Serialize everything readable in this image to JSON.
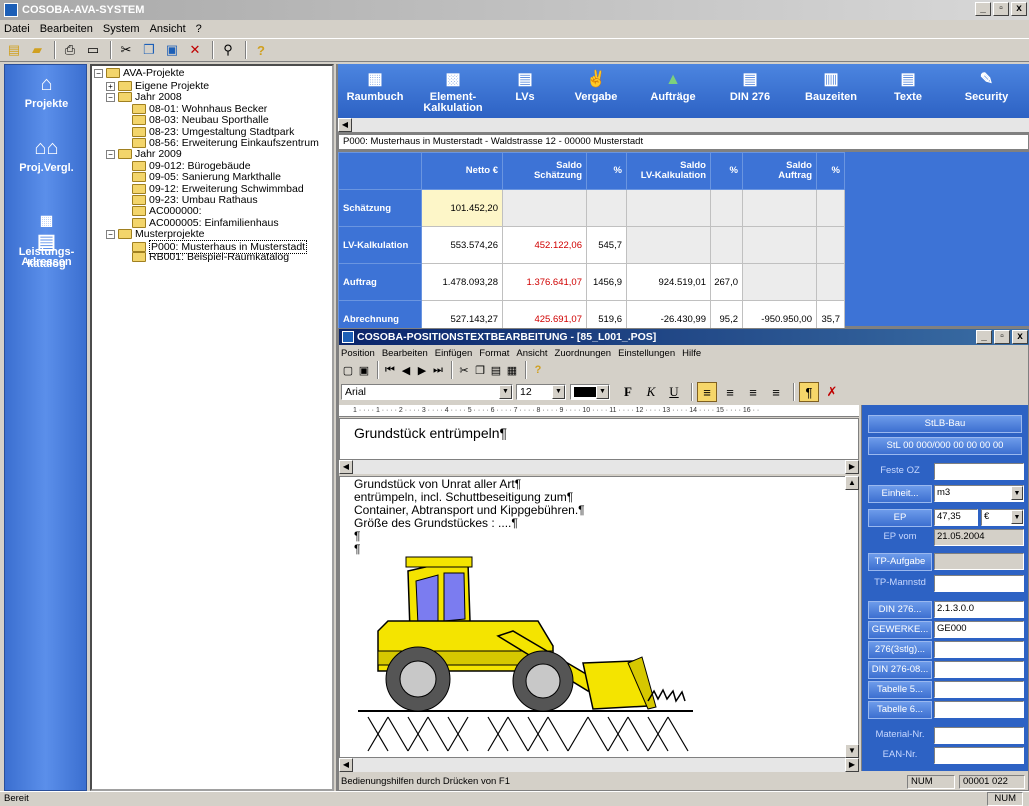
{
  "app": {
    "title": "COSOBA-AVA-SYSTEM",
    "win_min": "_",
    "win_max": "▫",
    "win_close": "x"
  },
  "menu": [
    "Datei",
    "Bearbeiten",
    "System",
    "Ansicht",
    "?"
  ],
  "toolbar_icons": [
    "new-icon",
    "open-icon",
    "print-icon",
    "print-preview-icon",
    "cut-icon",
    "copy-icon",
    "paste-icon",
    "delete-icon",
    "find-icon",
    "help-icon"
  ],
  "nav": [
    {
      "label": "Projekte",
      "icon": "house-icon"
    },
    {
      "label": "Proj.Vergl.",
      "icon": "houses-compare-icon"
    },
    {
      "label": "Leistungs-\nkatalog",
      "icon": "catalog-icon"
    },
    {
      "label": "Adressen",
      "icon": "address-book-icon"
    }
  ],
  "tree": {
    "root": "AVA-Projekte",
    "nodes": [
      {
        "label": "Eigene Projekte",
        "level": 1,
        "type": "group",
        "expanded": false
      },
      {
        "label": "Jahr 2008",
        "level": 1,
        "type": "group",
        "expanded": true
      },
      {
        "label": "08-01: Wohnhaus Becker",
        "level": 2,
        "type": "folder"
      },
      {
        "label": "08-03: Neubau Sporthalle",
        "level": 2,
        "type": "folder"
      },
      {
        "label": "08-23: Umgestaltung Stadtpark",
        "level": 2,
        "type": "folder"
      },
      {
        "label": "08-56: Erweiterung Einkaufszentrum",
        "level": 2,
        "type": "folder"
      },
      {
        "label": "Jahr 2009",
        "level": 1,
        "type": "group",
        "expanded": true
      },
      {
        "label": "09-012: Bürogebäude",
        "level": 2,
        "type": "folder"
      },
      {
        "label": "09-05: Sanierung Markthalle",
        "level": 2,
        "type": "folder"
      },
      {
        "label": "09-12: Erweiterung Schwimmbad",
        "level": 2,
        "type": "folder"
      },
      {
        "label": "09-23: Umbau Rathaus",
        "level": 2,
        "type": "folder"
      },
      {
        "label": "AC000000:",
        "level": 2,
        "type": "folder"
      },
      {
        "label": "AC000005: Einfamilienhaus",
        "level": 2,
        "type": "folder"
      },
      {
        "label": "Musterprojekte",
        "level": 1,
        "type": "group",
        "expanded": true
      },
      {
        "label": "P000: Musterhaus in Musterstadt",
        "level": 2,
        "type": "folder",
        "selected": true
      },
      {
        "label": "RB001: Beispiel-Raumkatalog",
        "level": 2,
        "type": "folder"
      }
    ]
  },
  "tabs": [
    {
      "label": "Raumbuch",
      "icon": "room-book-icon"
    },
    {
      "label": "Element-\nKalkulation",
      "icon": "element-calc-icon"
    },
    {
      "label": "LVs",
      "icon": "lv-icon"
    },
    {
      "label": "Vergabe",
      "icon": "handshake-icon"
    },
    {
      "label": "Aufträge",
      "icon": "orders-icon"
    },
    {
      "label": "DIN 276",
      "icon": "din-icon"
    },
    {
      "label": "Bauzeiten",
      "icon": "schedule-icon"
    },
    {
      "label": "Texte",
      "icon": "texts-icon"
    },
    {
      "label": "Security",
      "icon": "security-icon"
    }
  ],
  "project_info": "P000: Musterhaus in Musterstadt - Waldstrasse 12 - 00000 Musterstadt",
  "calc": {
    "headers": [
      "Netto €",
      "Saldo\nSchätzung",
      "%",
      "Saldo\nLV-Kalkulation",
      "%",
      "Saldo\nAuftrag",
      "%"
    ],
    "rows": [
      {
        "label": "Schätzung",
        "cells": [
          "101.452,20",
          "",
          "",
          "",
          "",
          "",
          ""
        ]
      },
      {
        "label": "LV-Kalkulation",
        "cells": [
          "553.574,26",
          "452.122,06",
          "545,7",
          "",
          "",
          "",
          ""
        ]
      },
      {
        "label": "Auftrag",
        "cells": [
          "1.478.093,28",
          "1.376.641,07",
          "1456,9",
          "924.519,01",
          "267,0",
          "",
          ""
        ]
      },
      {
        "label": "Abrechnung",
        "cells": [
          "527.143,27",
          "425.691,07",
          "519,6",
          "-26.430,99",
          "95,2",
          "-950.950,00",
          "35,7"
        ]
      }
    ]
  },
  "ptwin": {
    "title": "COSOBA-POSITIONSTEXTBEARBEITUNG - [85_L001_.POS]",
    "menu": [
      "Position",
      "Bearbeiten",
      "Einfügen",
      "Format",
      "Ansicht",
      "Zuordnungen",
      "Einstellungen",
      "Hilfe"
    ],
    "font": "Arial",
    "font_size": "12",
    "ruler": "1 · · · · 1 · · · · 2 · · · · 3 · · · · 4 · · · · 5 · · · · 6 · · · · 7 · · · · 8 · · · · 9 · · · · 10 · · · · 11 · · · · 12 · · · · 13 · · · · 14 · · · · 15 · · · · 16 · ·",
    "short_text": "Grundstück entrümpeln¶",
    "long_text": [
      "Grundstück von Unrat aller Art¶",
      "entrümpeln, incl. Schuttbeseitigung zum¶",
      "Container, Abtransport und Kippgebühren.¶",
      "Größe des Grundstückes : ....¶",
      "¶",
      "¶"
    ],
    "status": "Bedienungshilfen durch Drücken von  F1",
    "status_num": "NUM",
    "status_pos": "00001  022"
  },
  "side": {
    "header": "StLB-Bau",
    "code": "StL 00 000/000 00 00 00 00",
    "feste_oz": "Feste OZ",
    "einheit_btn": "Einheit...",
    "einheit_val": "m3",
    "ep_btn": "EP",
    "ep_val": "47,35",
    "currency": "€",
    "ep_vom": "EP vom",
    "ep_vom_val": "21.05.2004",
    "tp_aufgabe": "TP-Aufgabe",
    "tp_mannstd": "TP-Mannstd",
    "din276": "DIN 276...",
    "din276_val": "2.1.3.0.0",
    "gewerke": "GEWERKE...",
    "gewerke_val": "GE000",
    "b276": "276(3stlg)...",
    "din27608": "DIN 276-08...",
    "tab5": "Tabelle 5...",
    "tab6": "Tabelle 6...",
    "material": "Material-Nr.",
    "ean": "EAN-Nr."
  },
  "statusbar": {
    "left": "Bereit",
    "right": "NUM"
  }
}
